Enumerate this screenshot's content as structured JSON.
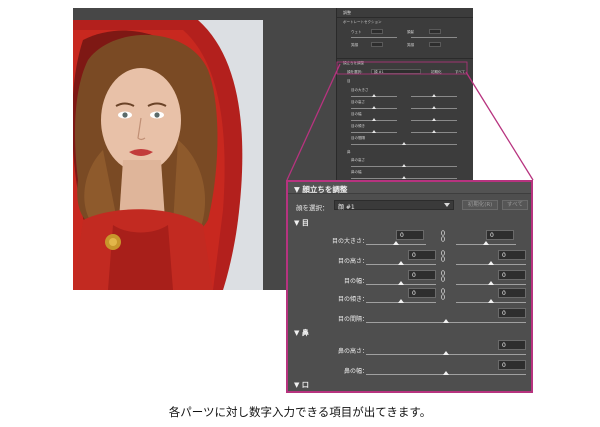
{
  "background_panel": {
    "title": "調整",
    "section_portrait": "ポートレートセクション",
    "rows": [
      {
        "label": "ウェト",
        "value": "0",
        "label2": "頭髪",
        "value2": "0"
      },
      {
        "label": "笑顔",
        "value": "0",
        "label2": "笑顔",
        "value2": "0"
      }
    ],
    "section_face": "顔立ちを調整",
    "face_select_label": "顔を選択：",
    "face_select_value": "顔 #1",
    "button_reset": "初期化",
    "button_all": "すべて",
    "small_labels": [
      "目",
      "目の大きさ",
      "目の高さ",
      "目の幅",
      "目の傾き",
      "目の間隔",
      "鼻",
      "鼻の高さ",
      "鼻の幅",
      "口",
      "笑顔",
      "上唇"
    ]
  },
  "zoom_panel": {
    "title": "顔立ちを調整",
    "select_label": "顔を選択：",
    "select_value": "顔 #1",
    "reset_button": "初期化(R)",
    "all_button": "すべて",
    "eye_section": "目",
    "eye_size_label": "目の大きさ：",
    "eye_height_label": "目の高さ：",
    "eye_width_label": "目の幅：",
    "eye_tilt_label": "目の傾き：",
    "eye_distance_label": "目の間隔：",
    "nose_section": "鼻",
    "nose_height_label": "鼻の高さ：",
    "nose_width_label": "鼻の幅：",
    "mouth_section": "口",
    "eye_size_left": "0",
    "eye_size_right": "0",
    "eye_height_left": "0",
    "eye_height_right": "0",
    "eye_width_left": "0",
    "eye_width_right": "0",
    "eye_tilt_left": "0",
    "eye_tilt_right": "0",
    "eye_distance": "0",
    "nose_height": "0",
    "nose_width": "0"
  },
  "colors": {
    "callout": "#b7337f",
    "panel_bg": "#4e4e4e"
  },
  "caption": "各パーツに対し数字入力できる項目が出てきます。"
}
